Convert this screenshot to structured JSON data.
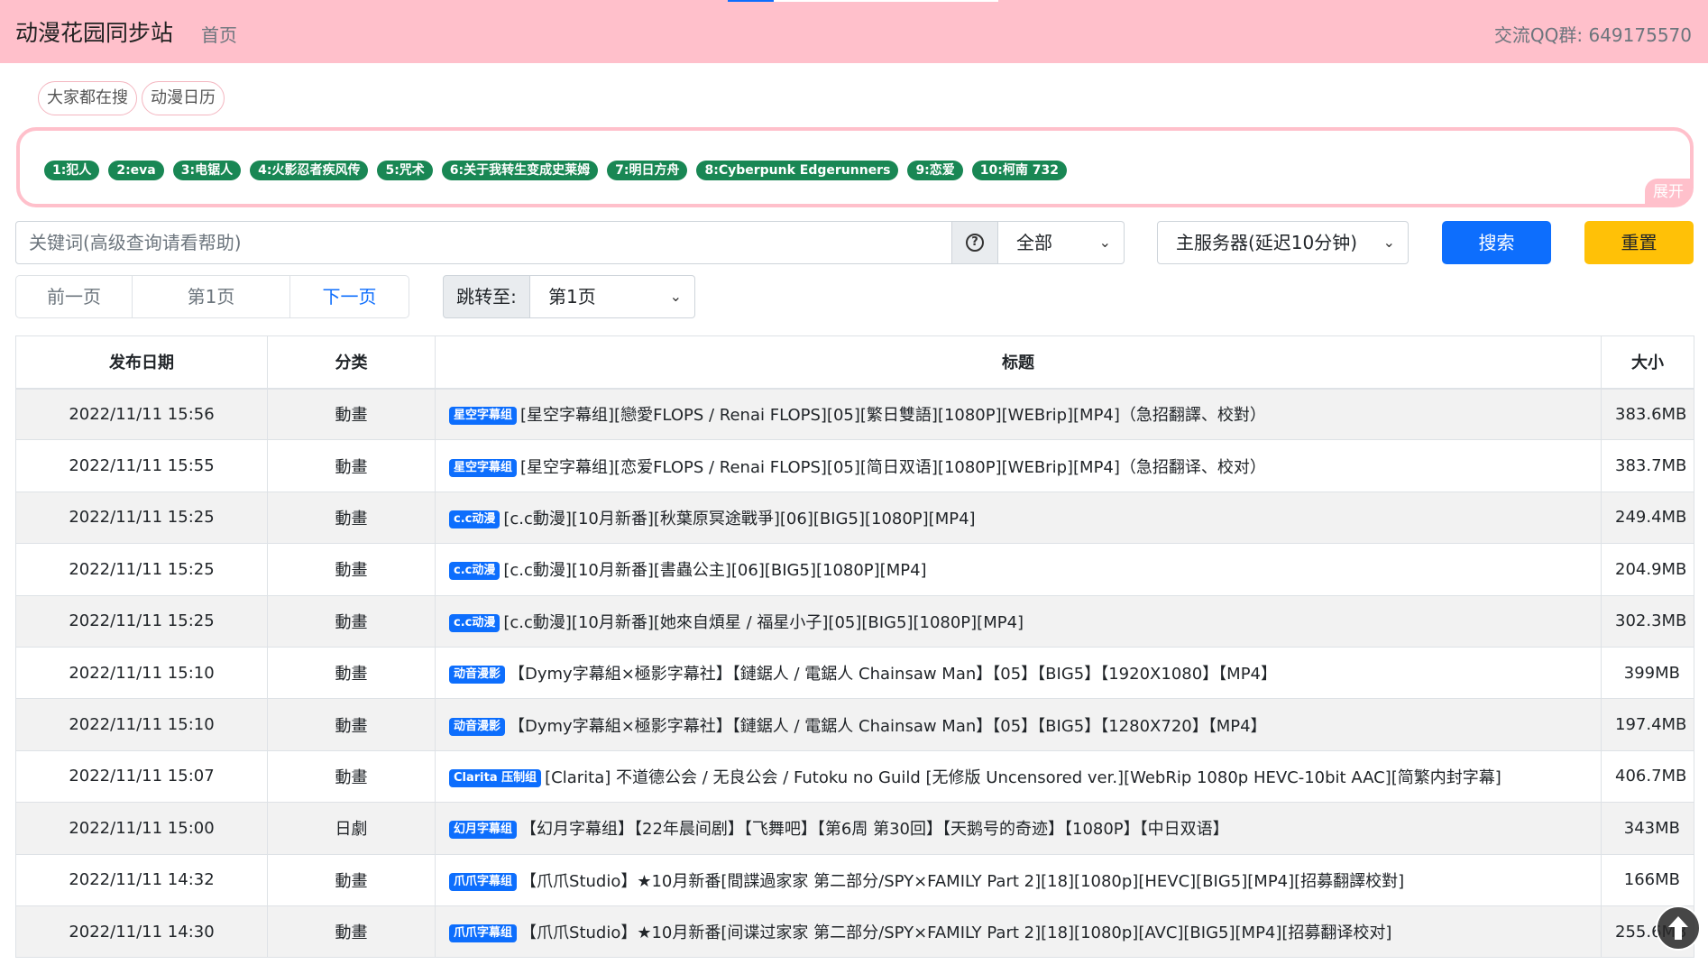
{
  "nav": {
    "brand": "动漫花园同步站",
    "home": "首页",
    "qq_group": "交流QQ群: 649175570",
    "load_progress": 0.17
  },
  "quick_links": [
    "大家都在搜",
    "动漫日历"
  ],
  "hot_searches": [
    "1:犯人",
    "2:eva",
    "3:电锯人",
    "4:火影忍者疾风传",
    "5:咒术",
    "6:关于我转生变成史莱姆",
    "7:明日方舟",
    "8:Cyberpunk Edgerunners",
    "9:恋爱",
    "10:柯南 732"
  ],
  "expand_label": "展开",
  "search": {
    "placeholder": "关键词(高级查询请看帮助)",
    "help_icon": "question-circle-icon",
    "category": "全部",
    "server": "主服务器(延迟10分钟)",
    "search_label": "搜索",
    "reset_label": "重置"
  },
  "pager": {
    "prev": "前一页",
    "current": "第1页",
    "next": "下一页",
    "jump_label": "跳转至:",
    "jump_value": "第1页"
  },
  "table": {
    "headers": [
      "发布日期",
      "分类",
      "标题",
      "大小"
    ],
    "rows": [
      {
        "date": "2022/11/11 15:56",
        "category": "動畫",
        "badge": "星空字幕组",
        "title": "[星空字幕组][戀愛FLOPS / Renai FLOPS][05][繁日雙語][1080P][WEBrip][MP4]（急招翻譯、校對）",
        "size": "383.6MB"
      },
      {
        "date": "2022/11/11 15:55",
        "category": "動畫",
        "badge": "星空字幕组",
        "title": "[星空字幕组][恋爱FLOPS / Renai FLOPS][05][简日双语][1080P][WEBrip][MP4]（急招翻译、校对）",
        "size": "383.7MB"
      },
      {
        "date": "2022/11/11 15:25",
        "category": "動畫",
        "badge": "c.c动漫",
        "title": "[c.c動漫][10月新番][秋葉原冥途戰爭][06][BIG5][1080P][MP4]",
        "size": "249.4MB"
      },
      {
        "date": "2022/11/11 15:25",
        "category": "動畫",
        "badge": "c.c动漫",
        "title": "[c.c動漫][10月新番][書蟲公主][06][BIG5][1080P][MP4]",
        "size": "204.9MB"
      },
      {
        "date": "2022/11/11 15:25",
        "category": "動畫",
        "badge": "c.c动漫",
        "title": "[c.c動漫][10月新番][她來自煩星 / 福星小子][05][BIG5][1080P][MP4]",
        "size": "302.3MB"
      },
      {
        "date": "2022/11/11 15:10",
        "category": "動畫",
        "badge": "动音漫影",
        "title": "【Dymy字幕組×極影字幕社】【鏈鋸人 / 電鋸人 Chainsaw Man】【05】【BIG5】【1920X1080】【MP4】",
        "size": "399MB"
      },
      {
        "date": "2022/11/11 15:10",
        "category": "動畫",
        "badge": "动音漫影",
        "title": "【Dymy字幕組×極影字幕社】【鏈鋸人 / 電鋸人 Chainsaw Man】【05】【BIG5】【1280X720】【MP4】",
        "size": "197.4MB"
      },
      {
        "date": "2022/11/11 15:07",
        "category": "動畫",
        "badge": "Clarita 压制组",
        "title": "[Clarita] 不道德公会 / 无良公会 / Futoku no Guild [无修版 Uncensored ver.][WebRip 1080p HEVC-10bit AAC][简繁内封字幕]",
        "size": "406.7MB"
      },
      {
        "date": "2022/11/11 15:00",
        "category": "日劇",
        "badge": "幻月字幕组",
        "title": "【幻月字幕组】【22年晨间剧】【飞舞吧】【第6周 第30回】【天鹅号的奇迹】【1080P】【中日双语】",
        "size": "343MB"
      },
      {
        "date": "2022/11/11 14:32",
        "category": "動畫",
        "badge": "爪爪字幕组",
        "title": "【爪爪Studio】★10月新番[間諜過家家 第二部分/SPY×FAMILY Part 2][18][1080p][HEVC][BIG5][MP4][招募翻譯校對]",
        "size": "166MB"
      },
      {
        "date": "2022/11/11 14:30",
        "category": "動畫",
        "badge": "爪爪字幕组",
        "title": "【爪爪Studio】★10月新番[间谍过家家 第二部分/SPY×FAMILY Part 2][18][1080p][AVC][BIG5][MP4][招募翻译校对]",
        "size": "255.6MB"
      }
    ]
  },
  "back_to_top_icon": "arrow-up-circle-icon"
}
